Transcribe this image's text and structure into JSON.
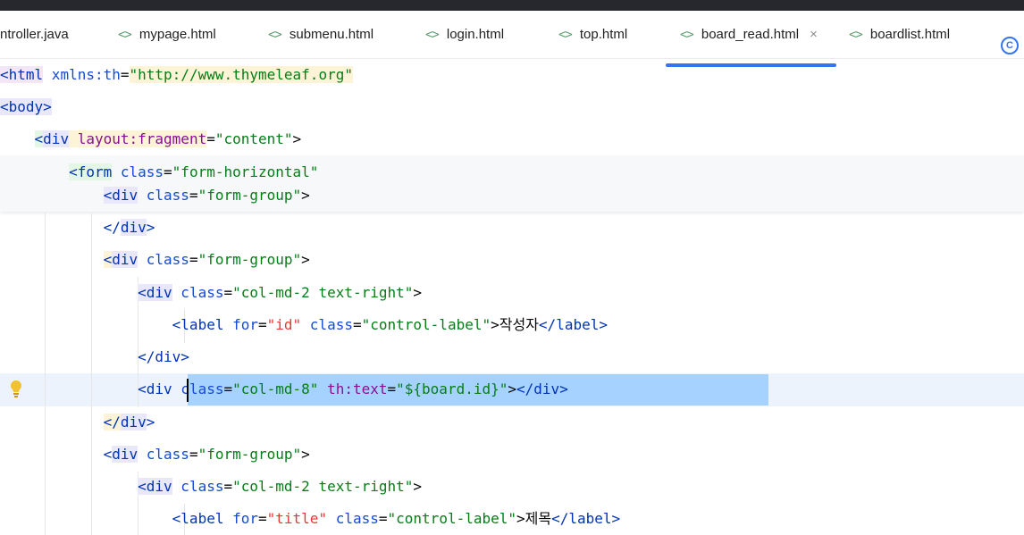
{
  "tabs": [
    {
      "label": "ntroller.java",
      "icon": "java-file-icon",
      "active": false
    },
    {
      "label": "mypage.html",
      "icon": "html-file-icon",
      "active": false
    },
    {
      "label": "submenu.html",
      "icon": "html-file-icon",
      "active": false
    },
    {
      "label": "login.html",
      "icon": "html-file-icon",
      "active": false
    },
    {
      "label": "top.html",
      "icon": "html-file-icon",
      "active": false
    },
    {
      "label": "board_read.html",
      "icon": "html-file-icon",
      "active": true
    },
    {
      "label": "boardlist.html",
      "icon": "html-file-icon",
      "active": false
    }
  ],
  "tab_icon_glyph": "<>",
  "close_glyph": "×",
  "badge_glyph": "C",
  "colors": {
    "accent": "#3574f0",
    "tag": "#0033b3",
    "string": "#067d17",
    "namespace": "#871094",
    "selection": "#a6d2ff"
  },
  "code": {
    "l1": {
      "open": "<",
      "tag": "html",
      "attr": " xmlns:th",
      "eq": "=",
      "val": "\"http://www.thymeleaf.org\""
    },
    "l2": {
      "open": "<",
      "tag": "body",
      "close": ">"
    },
    "l3": {
      "indent": "    ",
      "open": "<",
      "tag": "div",
      "attr": " layout:fragment",
      "eq": "=",
      "val": "\"content\"",
      "close": ">"
    },
    "l4": {
      "indent": "        ",
      "open": "<",
      "tag": "form",
      "attr": " class",
      "eq": "=",
      "val": "\"form-horizontal\""
    },
    "l5": {
      "indent": "            ",
      "open": "<",
      "tag": "div",
      "attr": " class",
      "eq": "=",
      "val": "\"form-group\"",
      "close": ">"
    },
    "l6": {
      "indent": "            ",
      "open": "</",
      "tag": "div",
      "close": ">"
    },
    "l7": {
      "indent": "            ",
      "open": "<",
      "tag": "div",
      "attr": " class",
      "eq": "=",
      "val": "\"form-group\"",
      "close": ">"
    },
    "l8": {
      "indent": "                ",
      "open": "<",
      "tag": "div",
      "attr": " class",
      "eq": "=",
      "val": "\"col-md-2 text-right\"",
      "close": ">"
    },
    "l9": {
      "indent": "                    ",
      "open": "<",
      "tag": "label",
      "attr1": " for",
      "eq1": "=",
      "val1": "\"id\"",
      "attr2": " class",
      "eq2": "=",
      "val2": "\"control-label\"",
      "mid": ">",
      "text": "작성자",
      "copen": "</",
      "ctag": "label",
      "close": ">"
    },
    "l10": {
      "indent": "                ",
      "open": "</",
      "tag": "div",
      "close": ">"
    },
    "l11": {
      "indent": "                ",
      "open": "<",
      "tag": "div",
      "attr1": " class",
      "eq1": "=",
      "val1": "\"col-md-8\"",
      "attr2": " th:text",
      "eq2": "=",
      "val2": "\"${board.id}\"",
      "mid": ">",
      "copen": "</",
      "ctag": "div",
      "close": ">"
    },
    "l12": {
      "indent": "            ",
      "open": "</",
      "tag": "div",
      "close": ">"
    },
    "l13": {
      "indent": "            ",
      "open": "<",
      "tag": "div",
      "attr": " class",
      "eq": "=",
      "val": "\"form-group\"",
      "close": ">"
    },
    "l14": {
      "indent": "                ",
      "open": "<",
      "tag": "div",
      "attr": " class",
      "eq": "=",
      "val": "\"col-md-2 text-right\"",
      "close": ">"
    },
    "l15": {
      "indent": "                    ",
      "open": "<",
      "tag": "label",
      "attr1": " for",
      "eq1": "=",
      "val1": "\"title\"",
      "attr2": " class",
      "eq2": "=",
      "val2": "\"control-label\"",
      "mid": ">",
      "text": "제목",
      "copen": "</",
      "ctag": "label",
      "close": ">"
    }
  }
}
